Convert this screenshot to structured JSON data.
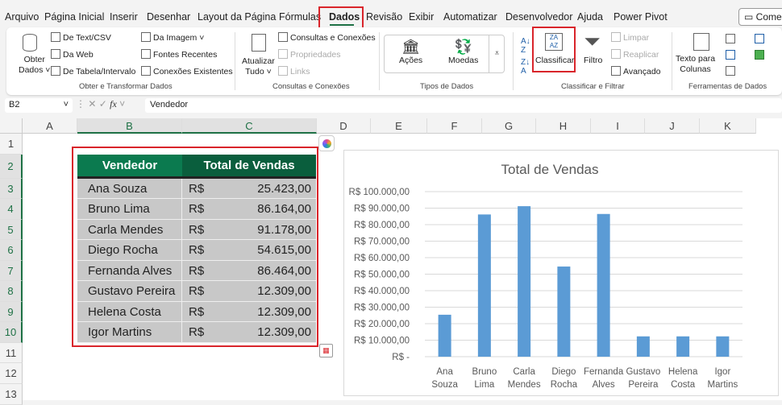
{
  "menu_tabs": [
    "Arquivo",
    "Página Inicial",
    "Inserir",
    "Desenhar",
    "Layout da Página",
    "Fórmulas",
    "Dados",
    "Revisão",
    "Exibir",
    "Automatizar",
    "Desenvolvedor",
    "Ajuda",
    "Power Pivot"
  ],
  "active_tab": "Dados",
  "comments_button": "Comentários",
  "ribbon": {
    "get_data": {
      "label1": "Obter",
      "label2": "Dados",
      "items": [
        "De Text/CSV",
        "Da Web",
        "De Tabela/Intervalo",
        "Da Imagem",
        "Fontes Recentes",
        "Conexões Existentes"
      ],
      "group": "Obter e Transformar Dados"
    },
    "queries": {
      "refresh1": "Atualizar",
      "refresh2": "Tudo",
      "items": [
        "Consultas e Conexões",
        "Propriedades",
        "Links"
      ],
      "group": "Consultas e Conexões"
    },
    "data_types": {
      "items": [
        "Ações",
        "Moedas"
      ],
      "group": "Tipos de Dados"
    },
    "sort_filter": {
      "sort": "Classificar",
      "filter": "Filtro",
      "items": [
        "Limpar",
        "Reaplicar",
        "Avançado"
      ],
      "group": "Classificar e Filtrar"
    },
    "tools": {
      "text_to_columns1": "Texto para",
      "text_to_columns2": "Colunas",
      "group": "Ferramentas de Dados"
    }
  },
  "formula_bar": {
    "name_box": "B2",
    "fx": "fx",
    "content": "Vendedor"
  },
  "columns": [
    "A",
    "B",
    "C",
    "D",
    "E",
    "F",
    "G",
    "H",
    "I",
    "J",
    "K"
  ],
  "rows": [
    "1",
    "2",
    "3",
    "4",
    "5",
    "6",
    "7",
    "8",
    "9",
    "10",
    "11",
    "12",
    "13"
  ],
  "table": {
    "headers": [
      "Vendedor",
      "Total de Vendas"
    ],
    "currency": "R$",
    "rows": [
      [
        "Ana Souza",
        "25.423,00"
      ],
      [
        "Bruno Lima",
        "86.164,00"
      ],
      [
        "Carla Mendes",
        "91.178,00"
      ],
      [
        "Diego Rocha",
        "54.615,00"
      ],
      [
        "Fernanda Alves",
        "86.464,00"
      ],
      [
        "Gustavo Pereira",
        "12.309,00"
      ],
      [
        "Helena Costa",
        "12.309,00"
      ],
      [
        "Igor Martins",
        "12.309,00"
      ]
    ],
    "header_color": "#107c41"
  },
  "chart_data": {
    "type": "bar",
    "title": "Total de Vendas",
    "categories": [
      "Ana Souza",
      "Bruno Lima",
      "Carla Mendes",
      "Diego Rocha",
      "Fernanda Alves",
      "Gustavo Pereira",
      "Helena Costa",
      "Igor Martins"
    ],
    "values": [
      25423,
      86164,
      91178,
      54615,
      86464,
      12309,
      12309,
      12309
    ],
    "ylim": [
      0,
      100000
    ],
    "yticks": [
      "R$ -",
      "R$ 10.000,00",
      "R$ 20.000,00",
      "R$ 30.000,00",
      "R$ 40.000,00",
      "R$ 50.000,00",
      "R$ 60.000,00",
      "R$ 70.000,00",
      "R$ 80.000,00",
      "R$ 90.000,00",
      "R$ 100.000,00"
    ],
    "grid": true,
    "bar_color": "#5b9bd5"
  }
}
